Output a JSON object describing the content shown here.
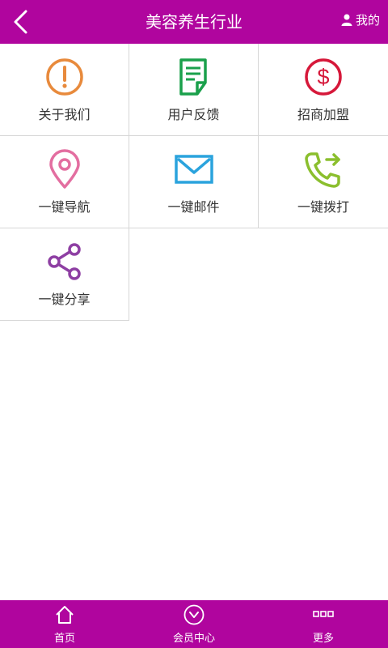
{
  "header": {
    "title": "美容养生行业",
    "profile_label": "我的"
  },
  "grid": {
    "items": [
      {
        "label": "关于我们",
        "icon": "info-circle-icon",
        "color": "#e88a3c"
      },
      {
        "label": "用户反馈",
        "icon": "document-icon",
        "color": "#1aa04b"
      },
      {
        "label": "招商加盟",
        "icon": "dollar-circle-icon",
        "color": "#d6183a"
      },
      {
        "label": "一键导航",
        "icon": "location-pin-icon",
        "color": "#e36ea0"
      },
      {
        "label": "一键邮件",
        "icon": "envelope-icon",
        "color": "#2aa3dd"
      },
      {
        "label": "一键拨打",
        "icon": "phone-call-icon",
        "color": "#8bbf2e"
      },
      {
        "label": "一键分享",
        "icon": "share-icon",
        "color": "#8e3fa3"
      }
    ]
  },
  "tabbar": {
    "tabs": [
      {
        "label": "首页",
        "icon": "home-icon"
      },
      {
        "label": "会员中心",
        "icon": "chevron-circle-icon"
      },
      {
        "label": "更多",
        "icon": "more-icon"
      }
    ]
  },
  "colors": {
    "brand": "#b0059e",
    "divider": "#d6d6d6"
  }
}
